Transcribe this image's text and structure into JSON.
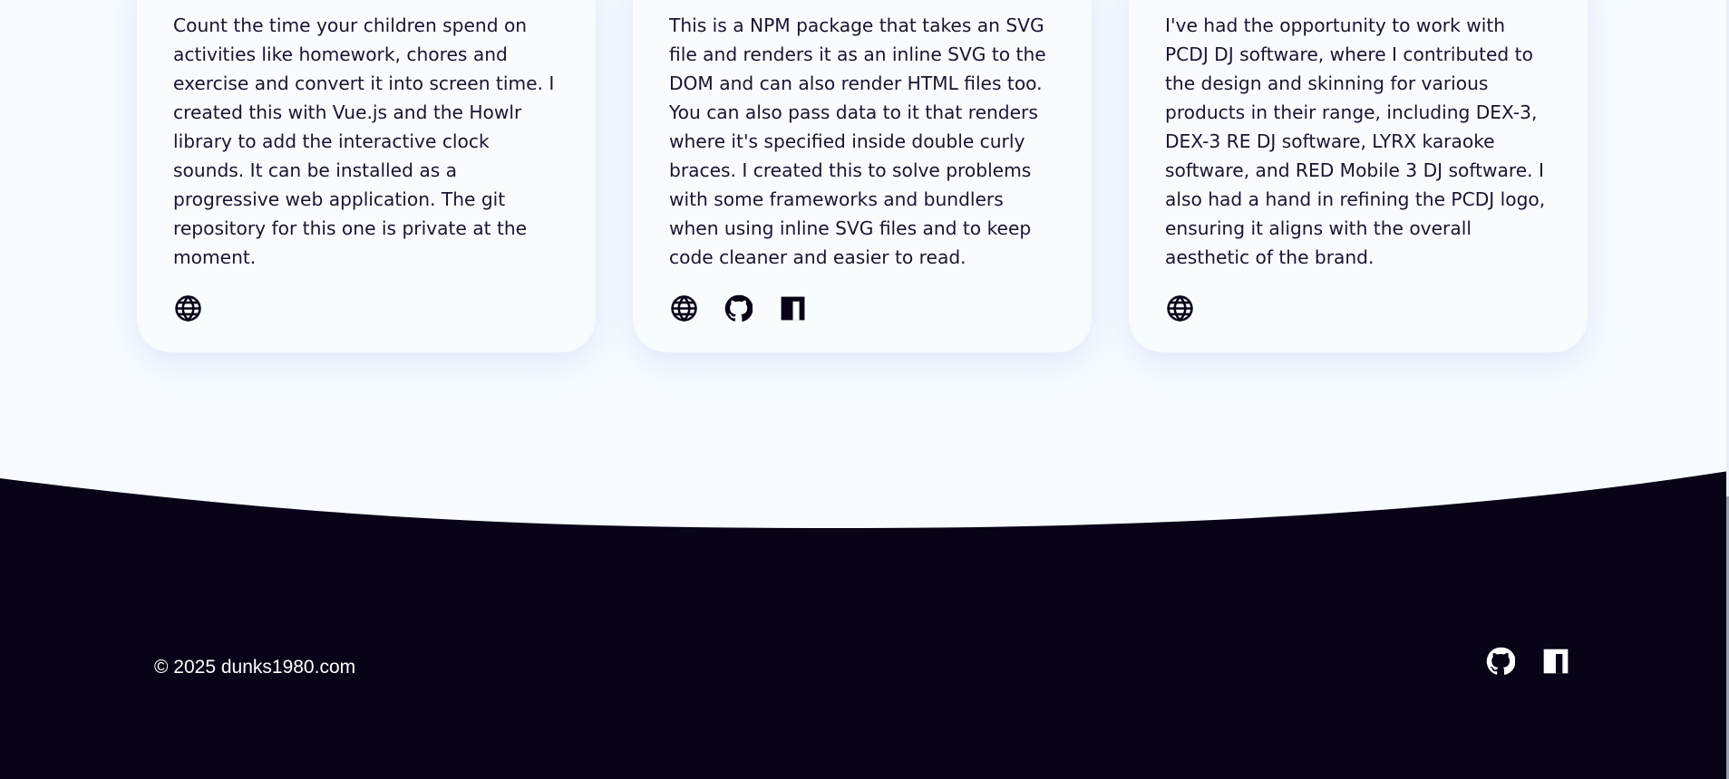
{
  "projects": [
    {
      "description": "Count the time your children spend on activities like homework, chores and exercise and convert it into screen time. I created this with Vue.js and the Howlr library to add the interactive clock sounds. It can be installed as a progressive web application. The git repository for this one is private at the moment.",
      "links": [
        "globe-icon"
      ]
    },
    {
      "description": "This is a NPM package that takes an SVG file and renders it as an inline SVG to the DOM and can also render HTML files too. You can also pass data to it that renders where it's specified inside double curly braces. I created this to solve problems with some frameworks and bundlers when using inline SVG files and to keep code cleaner and easier to read.",
      "links": [
        "globe-icon",
        "github-icon",
        "npm-icon"
      ]
    },
    {
      "description": "I've had the opportunity to work with PCDJ DJ software, where I contributed to the design and skinning for various products in their range, including DEX-3, DEX-3 RE DJ software, LYRX karaoke software, and RED Mobile 3 DJ software. I also had a hand in refining the PCDJ logo, ensuring it aligns with the overall aesthetic of the brand.",
      "links": [
        "globe-icon"
      ]
    }
  ],
  "footer": {
    "copyright": "© 2025 dunks1980.com",
    "links": [
      "github-icon",
      "npm-icon"
    ],
    "background_color": "#080316",
    "text_color": "#ffffff"
  },
  "colors": {
    "page_background": "#f7fbff",
    "card_background": "#f8fcff",
    "text": "#171630",
    "icon": "#080316"
  }
}
